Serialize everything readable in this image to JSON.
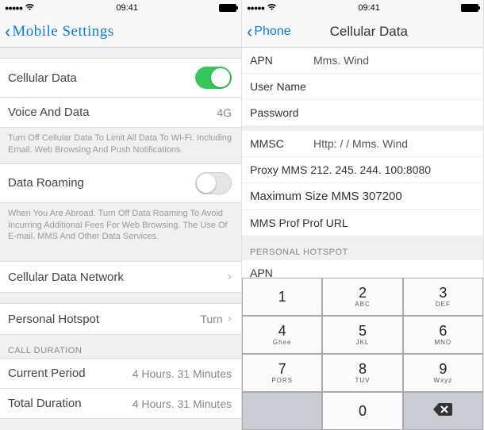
{
  "left": {
    "status": {
      "time": "09:41",
      "signal": "●●●●●",
      "wifi": "wifi"
    },
    "nav": {
      "title": "Mobile Settings"
    },
    "cellular_data_label": "Cellular Data",
    "voice_and_data": {
      "label": "Voice And Data",
      "value": "4G"
    },
    "note1": "Turn Off Cellular Data To Limit All Data To WI-Fi. Including Email. Web Browsing And Push Notifications.",
    "data_roaming_label": "Data Roaming",
    "note2": "When You Are Abroad. Turn Off Data Roaming To Avoid Incurring Additional Fees For Web Browsing. The Use Of E-mail. MMS And Other Data Services.",
    "cdn_label": "Cellular Data Network",
    "ph": {
      "label": "Personal Hotspot",
      "value": "Turn"
    },
    "section_call": "CALL DURATION",
    "current_period": {
      "label": "Current Period",
      "value": "4 Hours. 31 Minutes"
    },
    "total_duration": {
      "label": "Total Duration",
      "value": "4 Hours. 31 Minutes"
    }
  },
  "right": {
    "status": {
      "time": "09:41",
      "signal": "●●●●●"
    },
    "nav": {
      "back": "Phone",
      "title": "Cellular Data"
    },
    "fields": {
      "apn": {
        "label": "APN",
        "value": "Mms. Wind"
      },
      "username": {
        "label": "User Name",
        "value": ""
      },
      "password": {
        "label": "Password",
        "value": ""
      },
      "mmsc": {
        "label": "MMSC",
        "value": "Http: / / Mms. Wind"
      },
      "proxy": {
        "label": "Proxy MMS 212. 245. 244. 100:8080"
      },
      "maxsize": {
        "label": "Maximum Size MMS 307200"
      },
      "mmsprof": {
        "label": "MMS Prof Prof URL"
      }
    },
    "section_ph": "PERSONAL HOTSPOT",
    "ph_apn": {
      "label": "APN"
    },
    "keypad": [
      {
        "n": "1",
        "l": ""
      },
      {
        "n": "2",
        "l": "ABC"
      },
      {
        "n": "3",
        "l": "DEF"
      },
      {
        "n": "4",
        "l": "Ghee"
      },
      {
        "n": "5",
        "l": "JKL"
      },
      {
        "n": "6",
        "l": "MNO"
      },
      {
        "n": "7",
        "l": "PORS"
      },
      {
        "n": "8",
        "l": "TUV"
      },
      {
        "n": "9",
        "l": "Wxyz"
      },
      {
        "n": "",
        "l": ""
      },
      {
        "n": "0",
        "l": ""
      },
      {
        "n": "del",
        "l": ""
      }
    ]
  }
}
